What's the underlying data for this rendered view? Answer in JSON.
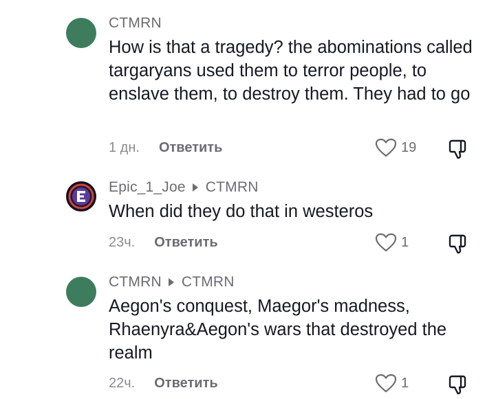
{
  "comments": [
    {
      "author": "CTMRN",
      "reply_to": "",
      "text": "How is that a tragedy? the abominations called targaryans used them to terror people, to enslave them, to destroy them. They had to go",
      "time": "1 дн.",
      "reply_label": "Ответить",
      "likes": "19"
    },
    {
      "author": "Epic_1_Joe",
      "reply_to": "CTMRN",
      "text": "When did they do that in westeros",
      "time": "23ч.",
      "reply_label": "Ответить",
      "likes": "1"
    },
    {
      "author": "CTMRN",
      "reply_to": "CTMRN",
      "text": "Aegon's conquest, Maegor's madness, Rhaenyra&Aegon's wars that destroyed the realm",
      "time": "22ч.",
      "reply_label": "Ответить",
      "likes": "1"
    }
  ],
  "colors": {
    "avatar_green": "#3d7d5e",
    "text_primary": "#161823",
    "text_secondary": "#6b6c73"
  },
  "icons": {
    "like": "heart-outline-icon",
    "dislike": "thumbs-down-outline-icon",
    "reply_arrow": "triangle-right-icon"
  }
}
